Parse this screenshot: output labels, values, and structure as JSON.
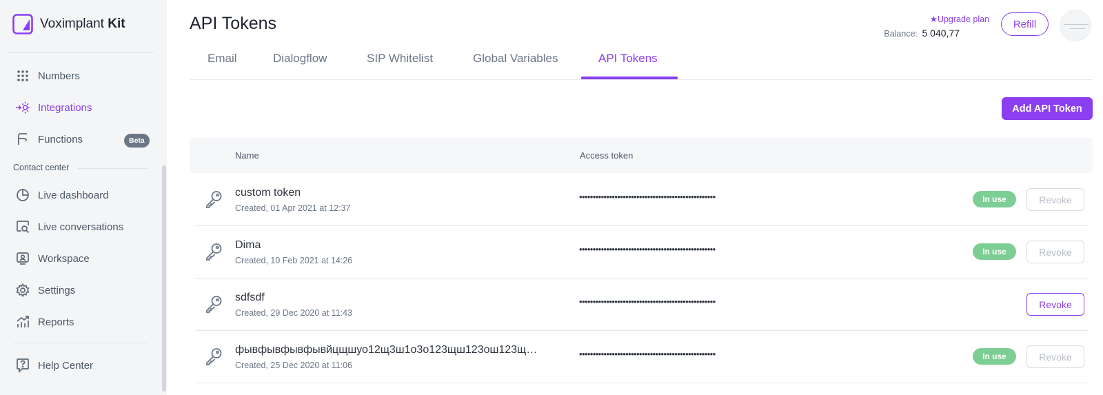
{
  "app": {
    "brand_regular": "Voximplant",
    "brand_bold": "Kit"
  },
  "sidebar": {
    "items": [
      {
        "label": "Numbers",
        "icon": "dots-grid-icon"
      },
      {
        "label": "Integrations",
        "icon": "integrations-icon",
        "active": true
      },
      {
        "label": "Functions",
        "icon": "functions-icon",
        "badge": "Beta"
      }
    ],
    "section_label": "Contact center",
    "contact_items": [
      {
        "label": "Live dashboard",
        "icon": "pie-chart-icon"
      },
      {
        "label": "Live conversations",
        "icon": "search-chat-icon"
      },
      {
        "label": "Workspace",
        "icon": "workspace-icon"
      },
      {
        "label": "Settings",
        "icon": "gear-icon"
      },
      {
        "label": "Reports",
        "icon": "reports-icon"
      }
    ],
    "help": {
      "label": "Help Center",
      "icon": "help-icon"
    }
  },
  "header": {
    "title": "API Tokens",
    "upgrade": "★Upgrade plan",
    "balance_label": "Balance:",
    "balance_value": "5 040,77",
    "refill": "Refill"
  },
  "tabs": [
    "Email",
    "Dialogflow",
    "SIP Whitelist",
    "Global Variables",
    "API Tokens"
  ],
  "active_tab": "API Tokens",
  "add_button": "Add API Token",
  "table": {
    "headers": {
      "name": "Name",
      "token": "Access token"
    },
    "rows": [
      {
        "name": "custom token",
        "created": "Created, 01 Apr 2021 at 12:37",
        "token": "••••••••••••••••••••••••••••••••••••••••••••••••••",
        "status": "In use",
        "revoke": "Revoke",
        "revoke_enabled": false
      },
      {
        "name": "Dima",
        "created": "Created, 10 Feb 2021 at 14:26",
        "token": "••••••••••••••••••••••••••••••••••••••••••••••••••",
        "status": "In use",
        "revoke": "Revoke",
        "revoke_enabled": false
      },
      {
        "name": "sdfsdf",
        "created": "Created, 29 Dec 2020 at 11:43",
        "token": "••••••••••••••••••••••••••••••••••••••••••••••••••",
        "status": "",
        "revoke": "Revoke",
        "revoke_enabled": true
      },
      {
        "name": "фывфывфывфывйцщшуо12щ3ш1о3о123щш123ош123щ…",
        "created": "Created, 25 Dec 2020 at 11:06",
        "token": "••••••••••••••••••••••••••••••••••••••••••••••••••",
        "status": "In use",
        "revoke": "Revoke",
        "revoke_enabled": false
      }
    ]
  },
  "colors": {
    "accent": "#8b3ff0",
    "badge_green": "#7dce94",
    "sidebar_bg": "#f4f5f7"
  }
}
